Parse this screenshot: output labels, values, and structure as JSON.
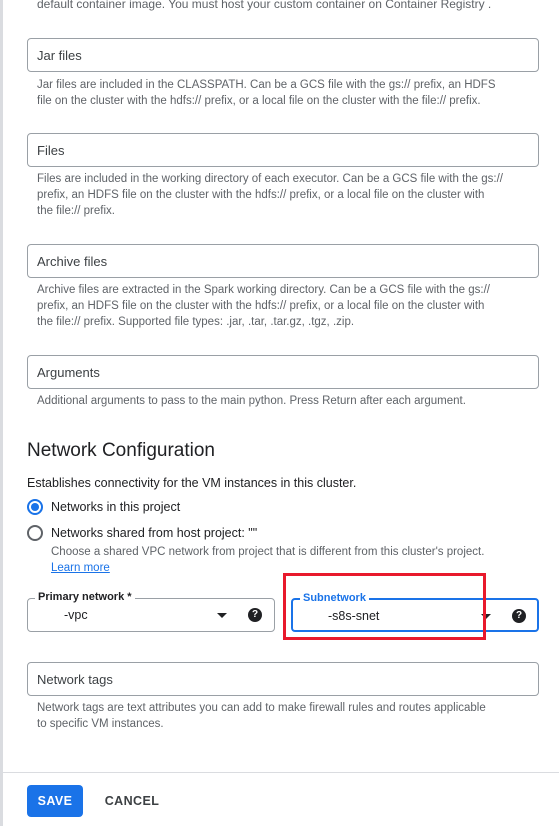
{
  "top_help": "default container image. You must host your custom container on Container Registry .",
  "jar_files": {
    "label": "Jar files",
    "help_lines": [
      "Jar files are included in the CLASSPATH. Can be a GCS file with the gs:// prefix, an HDFS",
      "file on the cluster with the hdfs:// prefix, or a local file on the cluster with the file:// prefix."
    ]
  },
  "files": {
    "label": "Files",
    "help_lines": [
      "Files are included in the working directory of each executor. Can be a GCS file with the gs://",
      "prefix, an HDFS file on the cluster with the hdfs:// prefix, or a local file on the cluster with",
      "the file:// prefix."
    ]
  },
  "archive_files": {
    "label": "Archive files",
    "help_lines": [
      "Archive files are extracted in the Spark working directory. Can be a GCS file with the gs://",
      "prefix, an HDFS file on the cluster with the hdfs:// prefix, or a local file on the cluster with",
      "the file:// prefix. Supported file types: .jar, .tar, .tar.gz, .tgz, .zip."
    ]
  },
  "arguments": {
    "label": "Arguments",
    "help": "Additional arguments to pass to the main python. Press Return after each argument."
  },
  "network": {
    "title": "Network Configuration",
    "description": "Establishes connectivity for the VM instances in this cluster.",
    "option_this_project": "Networks in this project",
    "option_shared": "Networks shared from host project: \"\"",
    "shared_help": "Choose a shared VPC network from project that is different from this cluster's project.",
    "learn_more": "Learn more",
    "selected_option": "Networks in this project",
    "primary_network_label": "Primary network *",
    "primary_network_value": "-vpc",
    "subnetwork_label": "Subnetwork",
    "subnetwork_value": "-s8s-snet",
    "help_icon": "?"
  },
  "network_tags": {
    "label": "Network tags",
    "help_lines": [
      "Network tags are text attributes you can add to make firewall rules and routes applicable",
      "to specific VM instances."
    ]
  },
  "actions": {
    "save": "SAVE",
    "cancel": "CANCEL"
  },
  "colors": {
    "accent": "#1a73e8",
    "highlight": "#e8192c"
  }
}
